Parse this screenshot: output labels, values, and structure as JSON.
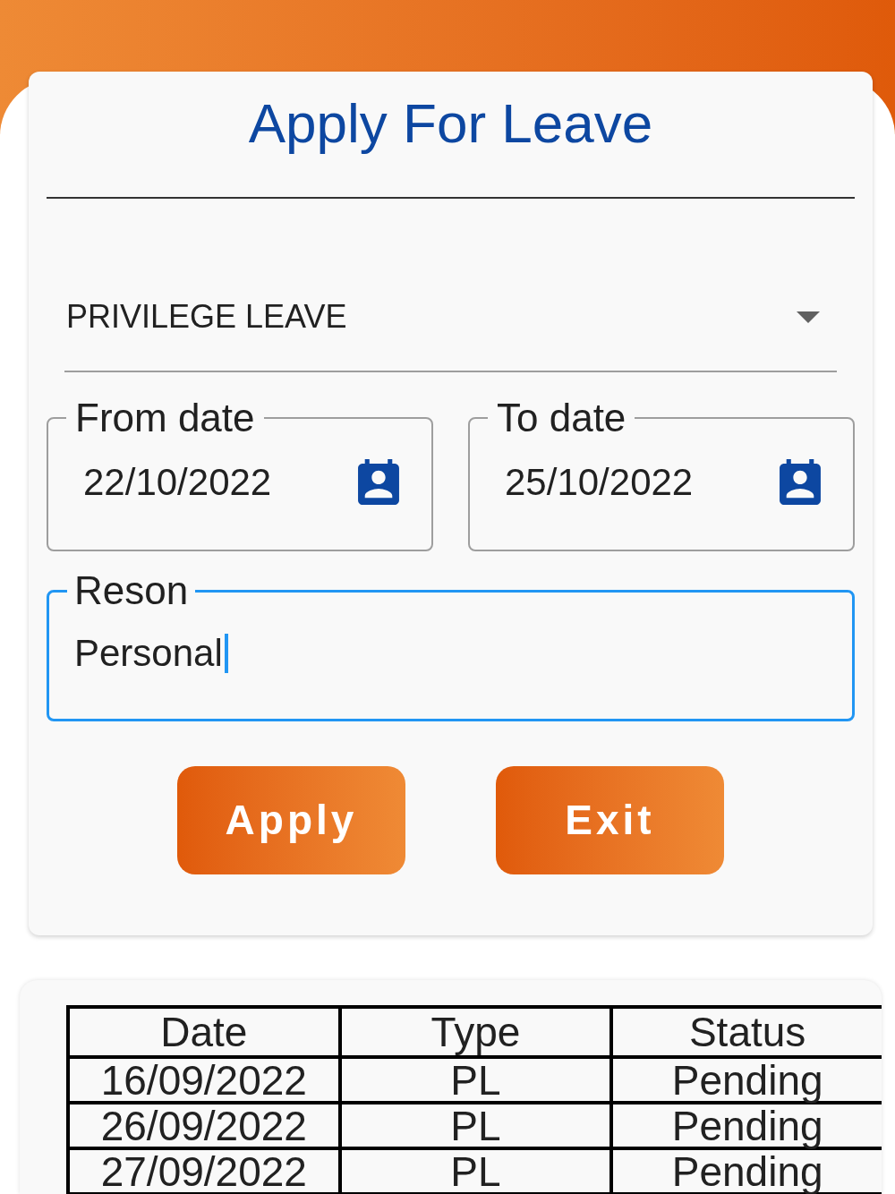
{
  "form": {
    "title": "Apply For Leave",
    "leave_type": {
      "value": "PRIVILEGE LEAVE"
    },
    "date_fields": [
      {
        "label": "From date",
        "value": "22/10/2022"
      },
      {
        "label": "To date",
        "value": "25/10/2022"
      }
    ],
    "reason": {
      "label": "Reson",
      "value": "Personal",
      "focused": true
    },
    "buttons": [
      "Apply",
      "Exit"
    ]
  },
  "history": {
    "columns": [
      "Date",
      "Type",
      "Status"
    ],
    "rows": [
      [
        "16/09/2022",
        "PL",
        "Pending"
      ],
      [
        "26/09/2022",
        "PL",
        "Pending"
      ],
      [
        "27/09/2022",
        "PL",
        "Pending"
      ]
    ]
  }
}
